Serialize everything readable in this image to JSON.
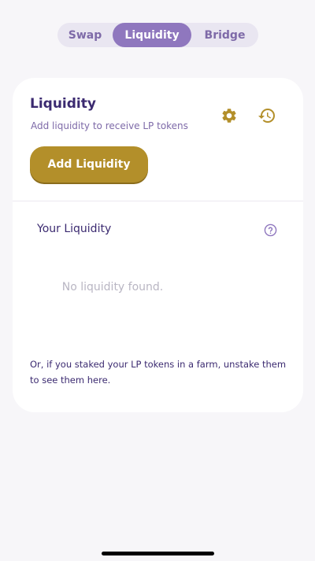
{
  "tabs": [
    {
      "label": "Swap",
      "active": false
    },
    {
      "label": "Liquidity",
      "active": true
    },
    {
      "label": "Bridge",
      "active": false
    }
  ],
  "card": {
    "title": "Liquidity",
    "subtitle": "Add liquidity to receive LP tokens",
    "add_button_label": "Add Liquidity",
    "your_liquidity_label": "Your Liquidity",
    "empty_message": "No liquidity found.",
    "footnote": "Or, if you staked your LP tokens in a farm, unstake them to see them here."
  },
  "icons": {
    "settings": "gear-icon",
    "history": "history-icon",
    "help": "question-circle-icon"
  },
  "colors": {
    "accent_purple": "#8f77be",
    "gold": "#b38f2a",
    "title_text": "#3b2a70",
    "secondary_text": "#7e6aa8",
    "muted_text": "#b9b6c3"
  }
}
